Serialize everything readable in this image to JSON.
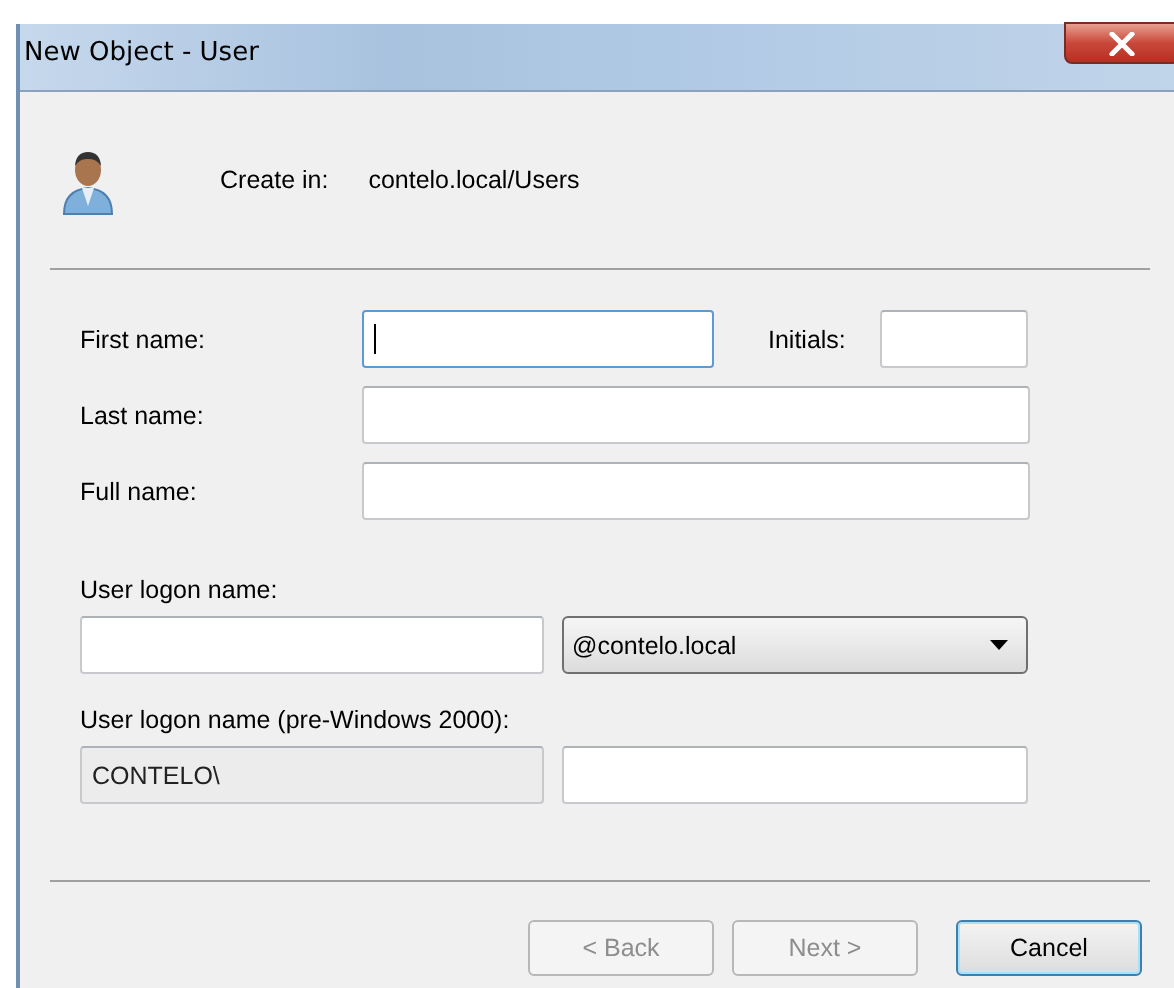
{
  "window": {
    "title": "New Object - User"
  },
  "create_in": {
    "label": "Create in:",
    "path": "contelo.local/Users"
  },
  "first_name": {
    "label": "First name:",
    "focused": true
  },
  "initials": {
    "label": "Initials:",
    "focused": false
  },
  "last_name": {
    "label": "Last name:",
    "focused": false
  },
  "full_name": {
    "label": "Full name:",
    "focused": false
  },
  "logon": {
    "label": "User logon name:",
    "domain": "@contelo.local"
  },
  "pre2000": {
    "label": "User logon name (pre-Windows 2000):",
    "domain": "CONTELO\\"
  },
  "buttons": [
    {
      "label": "< Back",
      "disabled": true,
      "default": false
    },
    {
      "label": "Next >",
      "disabled": true,
      "default": false
    },
    {
      "label": "Cancel",
      "disabled": false,
      "default": true
    }
  ]
}
